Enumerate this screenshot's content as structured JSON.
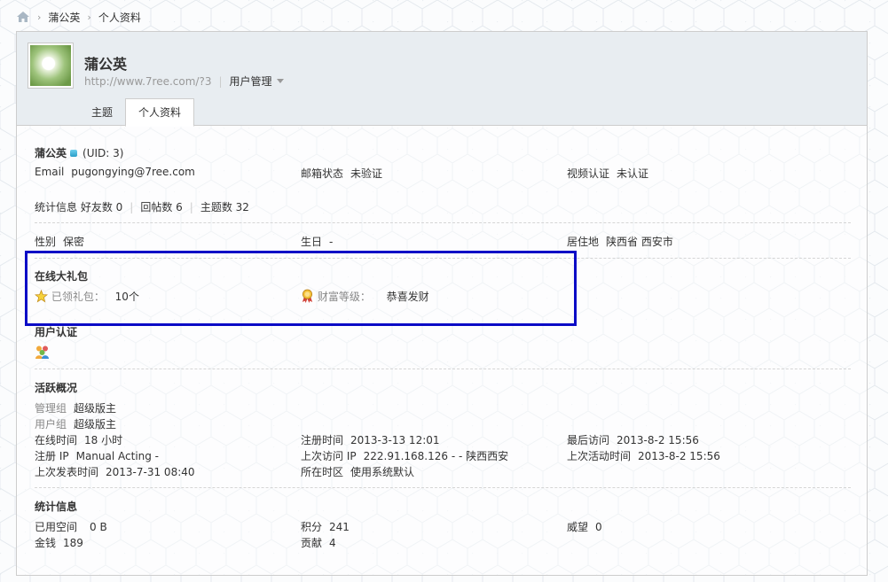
{
  "breadcrumb": {
    "items": [
      "蒲公英",
      "个人资料"
    ],
    "sep": "›"
  },
  "header": {
    "name": "蒲公英",
    "url": "http://www.7ree.com/?3",
    "user_mgmt": "用户管理",
    "tabs": [
      {
        "label": "主题",
        "active": false
      },
      {
        "label": "个人资料",
        "active": true
      }
    ]
  },
  "profile": {
    "name": "蒲公英",
    "uid": "(UID: 3)",
    "email_label": "Email",
    "email": "pugongying@7ree.com",
    "email_status_label": "邮箱状态",
    "email_status": "未验证",
    "video_label": "视频认证",
    "video_status": "未认证",
    "stats_label": "统计信息",
    "friends": "好友数 0",
    "replies": "回帖数 6",
    "topics": "主题数 32",
    "gender_label": "性别",
    "gender": "保密",
    "birthday_label": "生日",
    "birthday": "-",
    "residence_label": "居住地",
    "residence": "陕西省 西安市"
  },
  "gift": {
    "title": "在线大礼包",
    "received_label": "已领礼包：",
    "received_value": "10个",
    "wealth_label": "财富等级：",
    "wealth_value": "恭喜发财"
  },
  "verify": {
    "title": "用户认证"
  },
  "activity": {
    "title": "活跃概况",
    "admin_group_label": "管理组",
    "admin_group": "超级版主",
    "user_group_label": "用户组",
    "user_group": "超级版主",
    "online_label": "在线时间",
    "online": "18 小时",
    "reg_time_label": "注册时间",
    "reg_time": "2013-3-13 12:01",
    "last_visit_label": "最后访问",
    "last_visit": "2013-8-2 15:56",
    "reg_ip_label": "注册 IP",
    "reg_ip": "Manual Acting -",
    "last_ip_label": "上次访问 IP",
    "last_ip": "222.91.168.126 - - 陕西西安",
    "last_active_label": "上次活动时间",
    "last_active": "2013-8-2 15:56",
    "last_post_label": "上次发表时间",
    "last_post": "2013-7-31 08:40",
    "tz_label": "所在时区",
    "tz": "使用系统默认"
  },
  "stats": {
    "title": "统计信息",
    "space_label": "已用空间",
    "space": "0 B",
    "points_label": "积分",
    "points": "241",
    "prestige_label": "威望",
    "prestige": "0",
    "money_label": "金钱",
    "money": "189",
    "contrib_label": "贡献",
    "contrib": "4"
  },
  "colors": {
    "highlight_border": "#0b0bc6",
    "header_bg": "#e8edf1"
  }
}
